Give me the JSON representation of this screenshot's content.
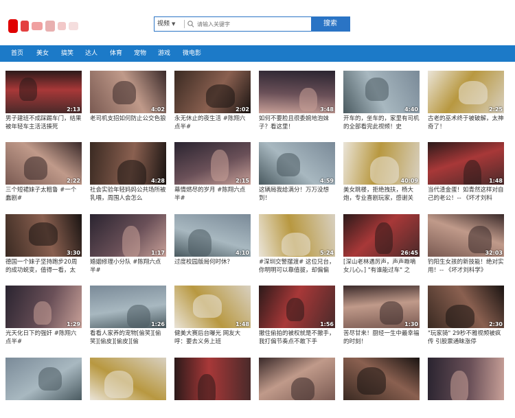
{
  "header": {
    "logo_text": "",
    "search": {
      "select_label": "视频",
      "placeholder": "请输入关键字",
      "button_label": "搜索"
    }
  },
  "nav": [
    "首页",
    "美女",
    "搞笑",
    "达人",
    "体育",
    "宠物",
    "游戏",
    "微电影"
  ],
  "colors": {
    "accent": "#1c7ac8",
    "search_border": "#2a74c5"
  },
  "rows": [
    [
      {
        "title": "男子建班不成踩踢车门，结果被年轻车主活活揍死",
        "duration": "2:13"
      },
      {
        "title": "老司机支招如何防止公交色狼",
        "duration": "4:02"
      },
      {
        "title": "永无休止的夜生活 #陈翔六点半#",
        "duration": "2:02"
      },
      {
        "title": "如何不要脸且很委婉地泡妹子？看这里！",
        "duration": "3:48"
      },
      {
        "title": "开车的，坐车的，家里有司机的全部看完此视频！史",
        "duration": "4:40"
      },
      {
        "title": "古老的巫术终于被破解，太神奇了！",
        "duration": "2:25"
      }
    ],
    [
      {
        "title": "三个短裙妹子太粗鲁 #一个蠢剧#",
        "duration": "2:22"
      },
      {
        "title": "社会实验年轻妈妈公共场所被乳喂，周围人会怎么",
        "duration": "4:28"
      },
      {
        "title": "幕情燃尽的岁月 #陈翔六点半#",
        "duration": "2:15"
      },
      {
        "title": "这辆局我给满分！万万没想到！",
        "duration": "4:59"
      },
      {
        "title": "美女跳楼，拒绝拽扶，杨大炮，专业喜剧玩家，感谢关",
        "duration": "40:09"
      },
      {
        "title": "当代渣金蛋！如青然这样对自己的老公！-- 《坏才刘科",
        "duration": "1:48"
      }
    ],
    [
      {
        "title": "德国一个妹子坚持跑步20周的成功蜕变，值得一看，太",
        "duration": "3:30"
      },
      {
        "title": "婚姻修理小分队 #陈翔六点半#",
        "duration": "1:17"
      },
      {
        "title": "过度校园版局何时休？",
        "duration": "4:10"
      },
      {
        "title": "#深圳交警摆渡# 这位兄台，你明明可以靠值拔，却偏偏",
        "duration": "5:24"
      },
      {
        "title": "[深山老林遇厉声，声声嘶嘀女儿心。] \"有谁能过车\" 之",
        "duration": "26:45"
      },
      {
        "title": "钓阳生女孩的新技能！绝对实用！-- 《坏才刘科学》",
        "duration": "32:03"
      }
    ],
    [
      {
        "title": "光天化日下的强奸 #陈翔六点半#",
        "duration": "1:29"
      },
      {
        "title": "看看人家养的宠物[偷笑][偷笑][偷皮][偷皮][偷",
        "duration": "1:26"
      },
      {
        "title": "健美大赛后台曝光 网友大呼：要去义务上班",
        "duration": "1:48"
      },
      {
        "title": "撤住偷拍的被权就是不撤手，我打偏节奏点不敢下手",
        "duration": "1:56"
      },
      {
        "title": "苦尽甘来！厨经一生中最幸福的时刻！",
        "duration": "1:30"
      },
      {
        "title": "\"玩家骑\" 29秒不雅视频被疯传 引股票通昧涨停",
        "duration": "2:30"
      }
    ],
    [
      {
        "title": "",
        "duration": ""
      },
      {
        "title": "",
        "duration": ""
      },
      {
        "title": "",
        "duration": ""
      },
      {
        "title": "",
        "duration": ""
      },
      {
        "title": "",
        "duration": ""
      },
      {
        "title": "",
        "duration": ""
      }
    ]
  ]
}
